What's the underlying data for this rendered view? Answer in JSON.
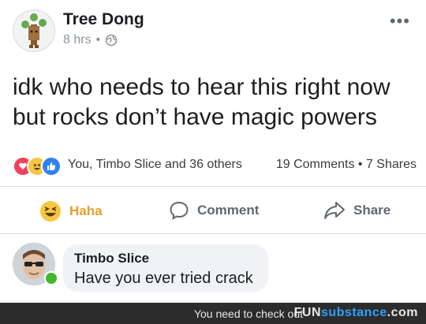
{
  "post": {
    "author": "Tree Dong",
    "time": "8 hrs",
    "text_line1": "idk who needs to hear this right now",
    "text_line2": "but rocks don’t have magic powers"
  },
  "reactions": {
    "names": "You, Timbo Slice and 36 others",
    "comments": "19 Comments",
    "shares": "7 Shares",
    "icons": [
      "heart-icon",
      "haha-icon",
      "like-icon"
    ]
  },
  "actions": {
    "haha_label": "Haha",
    "comment_label": "Comment",
    "share_label": "Share"
  },
  "comment": {
    "author": "Timbo Slice",
    "text": "Have you ever tried crack"
  },
  "footer": {
    "prefix": "You need to check out",
    "brand_a": "FUN",
    "brand_b": "substance",
    "brand_c": ".com"
  },
  "colors": {
    "haha_orange": "#e3a02b",
    "like_blue": "#2e81f4",
    "heart_red": "#f0415a",
    "online_green": "#42b72a"
  }
}
